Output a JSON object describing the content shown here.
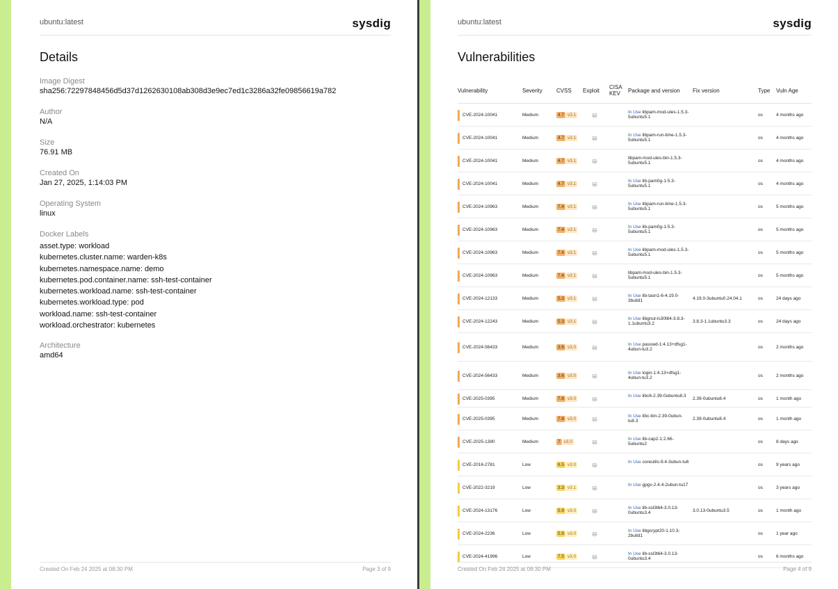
{
  "image_name": "ubuntu:latest",
  "brand": "sysdig",
  "page1": {
    "title": "Details",
    "fields": [
      {
        "label": "Image Digest",
        "value": "sha256:72297848456d5d37d1262630108ab308d3e9ec7ed1c3286a32fe09856619a782"
      },
      {
        "label": "Author",
        "value": "N/A"
      },
      {
        "label": "Size",
        "value": "76.91 MB"
      },
      {
        "label": "Created On",
        "value": "Jan 27, 2025, 1:14:03 PM"
      },
      {
        "label": "Operating System",
        "value": "linux"
      }
    ],
    "docker_labels_title": "Docker Labels",
    "docker_labels": [
      "asset.type: workload",
      "kubernetes.cluster.name: warden-k8s",
      "kubernetes.namespace.name: demo",
      "kubernetes.pod.container.name: ssh-test-container",
      "kubernetes.workload.name: ssh-test-container",
      "kubernetes.workload.type: pod",
      "workload.name: ssh-test-container",
      "workload.orchestrator: kubernetes"
    ],
    "architecture_label": "Architecture",
    "architecture": "amd64",
    "footer_created": "Created On Feb 24 2025 at 08:30 PM",
    "footer_page": "Page 3 of 9"
  },
  "page2": {
    "title": "Vulnerabilities",
    "columns": {
      "vulnerability": "Vulnerability",
      "severity": "Severity",
      "cvss": "CVSS",
      "exploit": "Exploit",
      "cisa_kev": "CISA KEV",
      "package": "Package and version",
      "fix": "Fix version",
      "type": "Type",
      "age": "Vuln Age"
    },
    "in_use_label": "In Use",
    "colors": {
      "medium_bar": "#f0a957",
      "low_bar": "#f2cd3e",
      "medium_score_bg": "#f4b266",
      "medium_ver_bg": "#fde6c6",
      "low_score_bg": "#f7d660",
      "low_ver_bg": "#fdf0bd"
    },
    "rows": [
      {
        "cve": "CVE-2024-10041",
        "severity": "Medium",
        "score": "4.7",
        "cvss_ver": "v3.1",
        "in_use": true,
        "package": "libpam-mod-ules-1.5.3-5ubuntu5.1",
        "fix": "",
        "type": "os",
        "age": "4 months ago"
      },
      {
        "cve": "CVE-2024-10041",
        "severity": "Medium",
        "score": "4.7",
        "cvss_ver": "v3.1",
        "in_use": true,
        "package": "libpam-run-time-1.5.3-5ubuntu5.1",
        "fix": "",
        "type": "os",
        "age": "4 months ago"
      },
      {
        "cve": "CVE-2024-10041",
        "severity": "Medium",
        "score": "4.7",
        "cvss_ver": "v3.1",
        "in_use": false,
        "package": "libpam-mod-ules-bin-1.5.3-5ubuntu5.1",
        "fix": "",
        "type": "os",
        "age": "4 months ago"
      },
      {
        "cve": "CVE-2024-10041",
        "severity": "Medium",
        "score": "4.7",
        "cvss_ver": "v3.1",
        "in_use": true,
        "package": "lib-pam0g-1.5.3-5ubuntu5.1",
        "fix": "",
        "type": "os",
        "age": "4 months ago"
      },
      {
        "cve": "CVE-2024-10963",
        "severity": "Medium",
        "score": "7.4",
        "cvss_ver": "v3.1",
        "in_use": true,
        "package": "libpam-run-time-1.5.3-5ubuntu5.1",
        "fix": "",
        "type": "os",
        "age": "5 months ago"
      },
      {
        "cve": "CVE-2024-10963",
        "severity": "Medium",
        "score": "7.4",
        "cvss_ver": "v3.1",
        "in_use": true,
        "package": "lib-pam0g-1.5.3-5ubuntu5.1",
        "fix": "",
        "type": "os",
        "age": "5 months ago"
      },
      {
        "cve": "CVE-2024-10963",
        "severity": "Medium",
        "score": "7.4",
        "cvss_ver": "v3.1",
        "in_use": true,
        "package": "libpam-mod-ules-1.5.3-5ubuntu5.1",
        "fix": "",
        "type": "os",
        "age": "5 months ago"
      },
      {
        "cve": "CVE-2024-10963",
        "severity": "Medium",
        "score": "7.4",
        "cvss_ver": "v3.1",
        "in_use": false,
        "package": "libpam-mod-ules-bin-1.5.3-5ubuntu5.1",
        "fix": "",
        "type": "os",
        "age": "5 months ago"
      },
      {
        "cve": "CVE-2024-12133",
        "severity": "Medium",
        "score": "5.3",
        "cvss_ver": "v3.1",
        "in_use": true,
        "package": "lib-tasn1-6-4.19.0-3build1",
        "fix": "4.19.0-3ubuntu0.24.04.1",
        "type": "os",
        "age": "24 days ago"
      },
      {
        "cve": "CVE-2024-12243",
        "severity": "Medium",
        "score": "5.3",
        "cvss_ver": "v3.1",
        "in_use": true,
        "package": "libgnut-ls30t64-3.8.3-1.1ubuntu3.2",
        "fix": "3.8.3-1.1ubuntu3.3",
        "type": "os",
        "age": "24 days ago"
      },
      {
        "cve": "CVE-2024-56433",
        "severity": "Medium",
        "score": "3.6",
        "cvss_ver": "v3.0",
        "in_use": true,
        "package": "passwd-1:4.13+dfsg1-4ubun-tu3.2",
        "fix": "",
        "type": "os",
        "age": "2 months ago"
      },
      {
        "cve": "CVE-2024-56433",
        "severity": "Medium",
        "score": "3.6",
        "cvss_ver": "v3.0",
        "in_use": true,
        "package": "login-1:4.13+dfsg1-4ubun-tu3.2",
        "fix": "",
        "type": "os",
        "age": "2 months ago"
      },
      {
        "cve": "CVE-2025-0395",
        "severity": "Medium",
        "score": "7.8",
        "cvss_ver": "v3.0",
        "in_use": true,
        "package": "libc6-2.39-0ubuntu8.3",
        "fix": "2.39-0ubuntu8.4",
        "type": "os",
        "age": "1 month ago"
      },
      {
        "cve": "CVE-2025-0395",
        "severity": "Medium",
        "score": "7.8",
        "cvss_ver": "v3.0",
        "in_use": true,
        "package": "libc-bin-2.39-0ubun-tu8.3",
        "fix": "2.39-0ubuntu8.4",
        "type": "os",
        "age": "1 month ago"
      },
      {
        "cve": "CVE-2025-1390",
        "severity": "Medium",
        "score": "7",
        "cvss_ver": "v3.0",
        "in_use": true,
        "package": "lib-cap2-1:2.66-5ubuntu2",
        "fix": "",
        "type": "os",
        "age": "8 days ago"
      },
      {
        "cve": "CVE-2016-2781",
        "severity": "Low",
        "score": "6.5",
        "cvss_ver": "v3.0",
        "in_use": true,
        "package": "coreutils-9.4-3ubun-tu6",
        "fix": "",
        "type": "os",
        "age": "9 years ago"
      },
      {
        "cve": "CVE-2022-3219",
        "severity": "Low",
        "score": "3.3",
        "cvss_ver": "v3.1",
        "in_use": true,
        "package": "gpgv-2.4.4-2ubun-tu17",
        "fix": "",
        "type": "os",
        "age": "3 years ago"
      },
      {
        "cve": "CVE-2024-13176",
        "severity": "Low",
        "score": "5.9",
        "cvss_ver": "v3.0",
        "in_use": true,
        "package": "lib-ssl3t64-3.0.13-0ubuntu3.4",
        "fix": "3.0.13-0ubuntu3.5",
        "type": "os",
        "age": "1 month ago"
      },
      {
        "cve": "CVE-2024-2236",
        "severity": "Low",
        "score": "5.9",
        "cvss_ver": "v3.0",
        "in_use": true,
        "package": "libgcrypt20-1.10.3-2build1",
        "fix": "",
        "type": "os",
        "age": "1 year ago"
      },
      {
        "cve": "CVE-2024-41996",
        "severity": "Low",
        "score": "7.5",
        "cvss_ver": "v3.0",
        "in_use": true,
        "package": "lib-ssl3t64-3.0.13-0ubuntu3.4",
        "fix": "",
        "type": "os",
        "age": "6 months ago"
      }
    ],
    "footer_created": "Created On Feb 24 2025 at 08:30 PM",
    "footer_page": "Page 4 of 9"
  }
}
